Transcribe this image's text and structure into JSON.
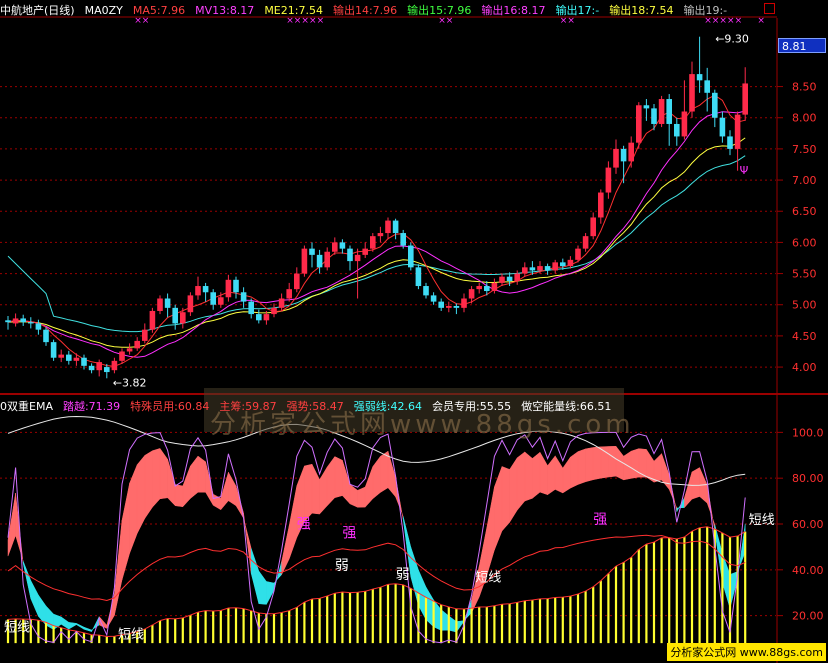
{
  "top_panel": {
    "legend": [
      {
        "text": "中航地产(日线)",
        "color": "#ffffff"
      },
      {
        "text": "MA0ZY",
        "color": "#ffffff"
      },
      {
        "text": "MA5:7.96",
        "color": "#ff4040"
      },
      {
        "text": "MV13:8.17",
        "color": "#ff40ff"
      },
      {
        "text": "ME21:7.54",
        "color": "#ffff40"
      },
      {
        "text": "输出14:7.96",
        "color": "#ff4040"
      },
      {
        "text": "输出15:7.96",
        "color": "#40ff40"
      },
      {
        "text": "输出16:8.17",
        "color": "#ff40ff"
      },
      {
        "text": "输出17:-",
        "color": "#40ffff"
      },
      {
        "text": "输出18:7.54",
        "color": "#ffff40"
      },
      {
        "text": "输出19:-",
        "color": "#c0c0c0"
      }
    ],
    "price_badge": "8.81",
    "high_note": "9.30",
    "low_note": "3.82",
    "psi_marker": "Ψ"
  },
  "bottom_panel": {
    "legend": [
      {
        "text": "0双重EMA",
        "color": "#ffffff"
      },
      {
        "text": "踏越:71.39",
        "color": "#ff40ff"
      },
      {
        "text": "特殊员用:60.84",
        "color": "#ff4040"
      },
      {
        "text": "主筹:59.87",
        "color": "#ff4040"
      },
      {
        "text": "强势:58.47",
        "color": "#ff4040"
      },
      {
        "text": "强弱线:42.64",
        "color": "#40ffff"
      },
      {
        "text": "会员专用:55.55",
        "color": "#ffffff"
      },
      {
        "text": "做空能量线:66.51",
        "color": "#ffffff"
      }
    ],
    "labels": {
      "strong": "强",
      "weak": "弱",
      "short_line": "短线"
    }
  },
  "watermark": "分析家公式网www.88gs.com",
  "credit": "分析家公式网 www.88gs.com",
  "colors": {
    "up": "#ff2a4a",
    "down": "#3fdcf5",
    "ma5": "#ff3030",
    "mv13": "#ff30ff",
    "me21": "#ffff40",
    "slow": "#40e0e0",
    "grid": "#9b0000",
    "axis": "#9b0000",
    "pink_fill": "#ff6b6b",
    "cyan_fill": "#2fe0e8",
    "hist": "#ffff30"
  },
  "chart_data": [
    {
      "type": "candlestick",
      "title": "中航地产(日线)",
      "ylim": [
        3.6,
        9.6
      ],
      "yticks": [
        "8.50",
        "8.00",
        "7.50",
        "7.00",
        "6.50",
        "6.00",
        "5.50",
        "5.00",
        "4.50",
        "4.00"
      ],
      "ytick_values": [
        8.5,
        8.0,
        7.5,
        7.0,
        6.5,
        6.0,
        5.5,
        5.0,
        4.5,
        4.0
      ],
      "candles": [
        [
          4.75,
          4.72,
          4.82,
          4.6
        ],
        [
          4.7,
          4.78,
          4.86,
          4.65
        ],
        [
          4.78,
          4.72,
          4.84,
          4.66
        ],
        [
          4.72,
          4.7,
          4.8,
          4.62
        ],
        [
          4.7,
          4.6,
          4.76,
          4.52
        ],
        [
          4.6,
          4.4,
          4.64,
          4.34
        ],
        [
          4.4,
          4.15,
          4.44,
          4.1
        ],
        [
          4.15,
          4.2,
          4.28,
          4.08
        ],
        [
          4.2,
          4.1,
          4.26,
          4.04
        ],
        [
          4.1,
          4.15,
          4.22,
          4.02
        ],
        [
          4.15,
          4.02,
          4.2,
          3.96
        ],
        [
          4.02,
          3.95,
          4.06,
          3.9
        ],
        [
          3.95,
          4.08,
          4.12,
          3.85
        ],
        [
          4.0,
          3.92,
          4.05,
          3.82
        ],
        [
          3.95,
          4.1,
          4.15,
          3.9
        ],
        [
          4.1,
          4.25,
          4.3,
          4.05
        ],
        [
          4.25,
          4.3,
          4.38,
          4.2
        ],
        [
          4.3,
          4.42,
          4.48,
          4.26
        ],
        [
          4.42,
          4.6,
          4.7,
          4.38
        ],
        [
          4.6,
          4.9,
          4.95,
          4.55
        ],
        [
          4.9,
          5.1,
          5.15,
          4.85
        ],
        [
          5.1,
          4.95,
          5.18,
          4.8
        ],
        [
          4.95,
          4.7,
          5.0,
          4.6
        ],
        [
          4.7,
          4.88,
          4.95,
          4.62
        ],
        [
          4.88,
          5.15,
          5.2,
          4.82
        ],
        [
          5.15,
          5.3,
          5.45,
          5.08
        ],
        [
          5.3,
          5.2,
          5.35,
          5.05
        ],
        [
          5.2,
          5.0,
          5.25,
          4.92
        ],
        [
          5.0,
          5.12,
          5.2,
          4.95
        ],
        [
          5.12,
          5.4,
          5.48,
          5.05
        ],
        [
          5.4,
          5.2,
          5.45,
          5.1
        ],
        [
          5.2,
          5.05,
          5.28,
          4.95
        ],
        [
          5.05,
          4.85,
          5.1,
          4.78
        ],
        [
          4.85,
          4.75,
          4.92,
          4.7
        ],
        [
          4.75,
          4.85,
          4.9,
          4.68
        ],
        [
          4.85,
          4.95,
          5.02,
          4.8
        ],
        [
          4.95,
          5.1,
          5.18,
          4.9
        ],
        [
          5.1,
          5.25,
          5.35,
          5.05
        ],
        [
          5.25,
          5.5,
          5.6,
          5.2
        ],
        [
          5.5,
          5.9,
          5.95,
          5.45
        ],
        [
          5.9,
          5.8,
          6.0,
          5.6
        ],
        [
          5.8,
          5.6,
          5.88,
          5.5
        ],
        [
          5.6,
          5.85,
          5.92,
          5.55
        ],
        [
          5.85,
          6.0,
          6.08,
          5.8
        ],
        [
          6.0,
          5.9,
          6.05,
          5.82
        ],
        [
          5.9,
          5.7,
          5.95,
          5.55
        ],
        [
          5.7,
          5.8,
          5.9,
          5.1
        ],
        [
          5.8,
          5.9,
          6.0,
          5.75
        ],
        [
          5.9,
          6.1,
          6.15,
          5.85
        ],
        [
          6.1,
          6.15,
          6.25,
          6.0
        ],
        [
          6.15,
          6.35,
          6.4,
          6.05
        ],
        [
          6.35,
          6.15,
          6.38,
          6.05
        ],
        [
          6.15,
          5.95,
          6.2,
          5.9
        ],
        [
          5.95,
          5.6,
          6.0,
          5.55
        ],
        [
          5.6,
          5.3,
          5.65,
          5.25
        ],
        [
          5.3,
          5.15,
          5.35,
          5.1
        ],
        [
          5.15,
          5.05,
          5.2,
          5.0
        ],
        [
          5.05,
          4.95,
          5.1,
          4.9
        ],
        [
          4.95,
          4.98,
          5.05,
          4.88
        ],
        [
          4.98,
          4.95,
          5.02,
          4.85
        ],
        [
          4.95,
          5.1,
          5.18,
          4.88
        ],
        [
          5.1,
          5.25,
          5.3,
          5.02
        ],
        [
          5.25,
          5.3,
          5.35,
          5.18
        ],
        [
          5.3,
          5.22,
          5.38,
          5.15
        ],
        [
          5.22,
          5.35,
          5.42,
          5.18
        ],
        [
          5.35,
          5.45,
          5.5,
          5.3
        ],
        [
          5.45,
          5.38,
          5.52,
          5.3
        ],
        [
          5.38,
          5.5,
          5.55,
          5.32
        ],
        [
          5.5,
          5.6,
          5.68,
          5.45
        ],
        [
          5.6,
          5.55,
          5.7,
          5.48
        ],
        [
          5.55,
          5.62,
          5.7,
          5.5
        ],
        [
          5.62,
          5.55,
          5.66,
          5.48
        ],
        [
          5.55,
          5.68,
          5.72,
          5.5
        ],
        [
          5.68,
          5.62,
          5.74,
          5.56
        ],
        [
          5.62,
          5.72,
          5.78,
          5.58
        ],
        [
          5.72,
          5.9,
          5.95,
          5.68
        ],
        [
          5.9,
          6.1,
          6.15,
          5.85
        ],
        [
          6.1,
          6.4,
          6.48,
          6.05
        ],
        [
          6.4,
          6.8,
          6.85,
          6.3
        ],
        [
          6.8,
          7.2,
          7.3,
          6.7
        ],
        [
          7.2,
          7.5,
          7.65,
          7.1
        ],
        [
          7.5,
          7.3,
          7.55,
          6.95
        ],
        [
          7.3,
          7.6,
          7.7,
          7.2
        ],
        [
          7.6,
          8.2,
          8.25,
          7.5
        ],
        [
          8.2,
          8.15,
          8.3,
          7.95
        ],
        [
          8.15,
          7.9,
          8.22,
          7.8
        ],
        [
          7.9,
          8.3,
          8.35,
          7.85
        ],
        [
          8.3,
          7.9,
          8.38,
          7.55
        ],
        [
          7.9,
          7.7,
          8.0,
          7.55
        ],
        [
          7.7,
          8.1,
          8.6,
          7.65
        ],
        [
          8.1,
          8.7,
          8.9,
          8.0
        ],
        [
          8.7,
          8.6,
          9.3,
          8.4
        ],
        [
          8.6,
          8.4,
          8.8,
          8.1
        ],
        [
          8.4,
          8.0,
          8.45,
          7.85
        ],
        [
          8.0,
          7.7,
          8.1,
          7.6
        ],
        [
          7.7,
          7.5,
          7.8,
          7.4
        ],
        [
          7.5,
          8.05,
          8.1,
          7.15
        ],
        [
          8.05,
          8.55,
          8.81,
          7.95
        ]
      ]
    },
    {
      "type": "indicator",
      "title": "0双重EMA",
      "ylim": [
        5,
        115
      ],
      "yticks": [
        "100.0",
        "80.00",
        "60.00",
        "40.00",
        "20.00"
      ],
      "ytick_values": [
        100,
        80,
        60,
        40,
        20
      ]
    }
  ]
}
